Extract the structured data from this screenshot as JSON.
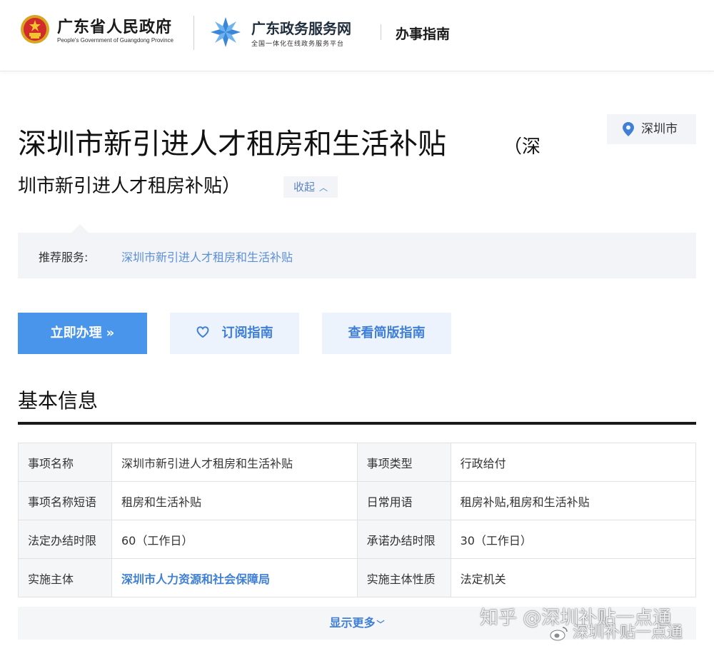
{
  "header": {
    "gov_name": "广东省人民政府",
    "gov_sub": "People's Government of Guangdong Province",
    "portal_name": "广东政务服务网",
    "portal_sub": "全国一体化在线政务服务平台",
    "guide_title": "办事指南"
  },
  "title": {
    "main": "深圳市新引进人才租房和生活补贴",
    "alias_start": "（深",
    "alias_rest": "圳市新引进人才租房补贴）",
    "collapse_label": "收起",
    "city": "深圳市"
  },
  "recommend": {
    "label": "推荐服务:",
    "link": "深圳市新引进人才租房和生活补贴"
  },
  "actions": {
    "apply": "立即办理",
    "apply_arrow": "»",
    "subscribe": "订阅指南",
    "simple": "查看简版指南"
  },
  "section": {
    "title": "基本信息"
  },
  "info_rows": [
    {
      "l1": "事项名称",
      "v1": "深圳市新引进人才租房和生活补贴",
      "l2": "事项类型",
      "v2": "行政给付"
    },
    {
      "l1": "事项名称短语",
      "v1": "租房和生活补贴",
      "l2": "日常用语",
      "v2": "租房补贴,租房和生活补贴"
    },
    {
      "l1": "法定办结时限",
      "v1": "60（工作日）",
      "l2": "承诺办结时限",
      "v2": "30（工作日）"
    },
    {
      "l1": "实施主体",
      "v1": "深圳市人力资源和社会保障局",
      "l2": "实施主体性质",
      "v2": "法定机关"
    }
  ],
  "more": {
    "label": "显示更多"
  },
  "watermark": {
    "line1": "知乎 @深圳补贴一点通",
    "line2": "深圳补贴一点通"
  },
  "colors": {
    "primary": "#4a95ec",
    "link": "#3f7fd6",
    "panel": "#f2f4f7"
  }
}
